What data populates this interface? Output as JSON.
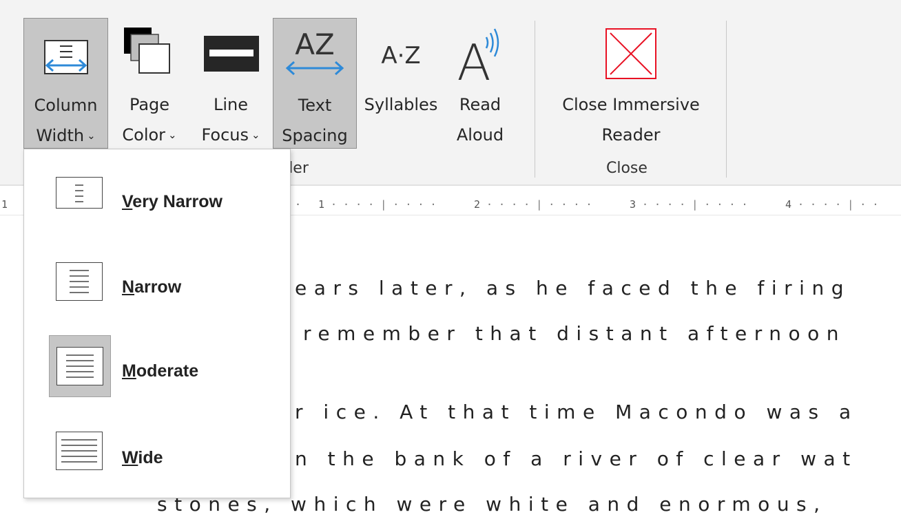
{
  "ribbon": {
    "column_width": {
      "line1": "Column",
      "line2": "Width",
      "chevron": "⌄"
    },
    "page_color": {
      "line1": "Page",
      "line2": "Color",
      "chevron": "⌄"
    },
    "line_focus": {
      "line1": "Line",
      "line2": "Focus",
      "chevron": "⌄"
    },
    "text_spacing": {
      "line1": "Text",
      "line2": "Spacing",
      "icon_text": "AZ"
    },
    "syllables": {
      "line1": "Syllables",
      "icon_text": "A·Z"
    },
    "read_aloud": {
      "line1": "Read",
      "line2": "Aloud",
      "icon_text": "A"
    },
    "close_immersive": {
      "line1": "Close Immersive",
      "line2": "Reader"
    },
    "groups": {
      "reader": "Reader",
      "close": "Close"
    }
  },
  "ruler": {
    "marks": [
      "1",
      "1",
      "2",
      "3",
      "4"
    ]
  },
  "document": {
    "lines": [
      "ears later, as he faced the firing",
      "remember that distant afternoon",
      "r ice. At that time Macondo was a",
      "n the bank of a river of clear wat",
      "stones, which were white and enormous,"
    ]
  },
  "column_width_menu": {
    "items": [
      {
        "mnemonic": "V",
        "rest": "ery Narrow",
        "selected": false
      },
      {
        "mnemonic": "N",
        "rest": "arrow",
        "selected": false
      },
      {
        "mnemonic": "M",
        "rest": "oderate",
        "selected": true
      },
      {
        "mnemonic": "W",
        "rest": "ide",
        "selected": false
      }
    ]
  },
  "colors": {
    "accent_blue": "#2e8ad8",
    "close_red": "#e81123",
    "selected_bg": "#c6c6c6",
    "ribbon_bg": "#f3f3f3"
  }
}
